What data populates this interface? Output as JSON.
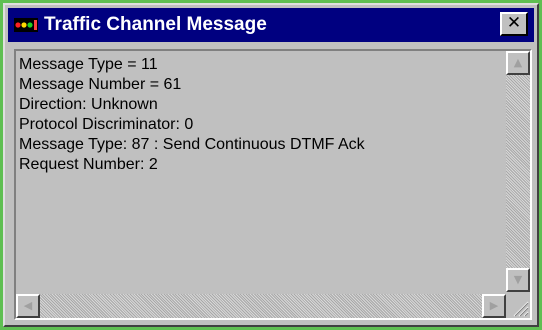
{
  "window": {
    "title": "Traffic Channel Message",
    "close_icon": "close-icon",
    "app_icon": "traffic-light-icon"
  },
  "content": {
    "lines": [
      "Message Type = 11",
      "Message Number = 61",
      "Direction: Unknown",
      "Protocol Discriminator: 0",
      "Message Type: 87 : Send Continuous DTMF Ack",
      "Request Number: 2"
    ]
  },
  "scrollbars": {
    "up_icon": "arrow-up-icon",
    "down_icon": "arrow-down-icon",
    "left_icon": "arrow-left-icon",
    "right_icon": "arrow-right-icon",
    "grip_icon": "resize-grip-icon"
  },
  "colors": {
    "titlebar": "#000080",
    "window_face": "#c0c0c0",
    "outer_frame": "#5fbf52"
  }
}
